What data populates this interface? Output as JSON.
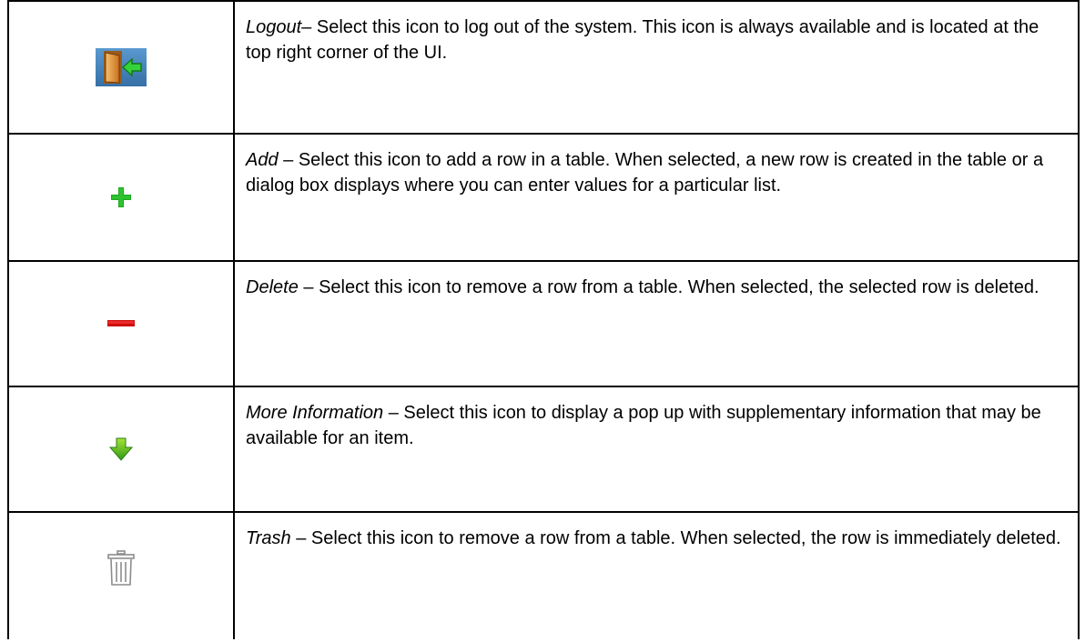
{
  "rows": [
    {
      "icon": "logout-icon",
      "name": "Logout",
      "separator": "– ",
      "text": "Select this icon to log out of the system. This icon is always available and is located at the top right corner of the UI."
    },
    {
      "icon": "add-icon",
      "name": "Add",
      "separator": " – ",
      "text": "Select this icon to add a row in a table. When selected, a new row is created in the table or a dialog box displays where you can enter values for a particular list."
    },
    {
      "icon": "delete-icon",
      "name": "Delete",
      "separator": " – ",
      "text": "Select this icon to remove a row from a table. When selected, the selected row is deleted."
    },
    {
      "icon": "more-information-icon",
      "name": "More Information",
      "separator": " – ",
      "text": "Select this icon to display a pop up with supplementary information that may be available for an item."
    },
    {
      "icon": "trash-icon",
      "name": "Trash",
      "separator": " – ",
      "text": "Select this icon to remove a row from a table. When selected, the row is immediately deleted."
    }
  ],
  "colors": {
    "add_green": "#22b022",
    "delete_red": "#dd1111",
    "more_info_green": "#3fae1a",
    "trash_gray": "#8a8a8a",
    "logout_blue": "#3f80b8",
    "logout_arrow": "#2fd02f"
  }
}
